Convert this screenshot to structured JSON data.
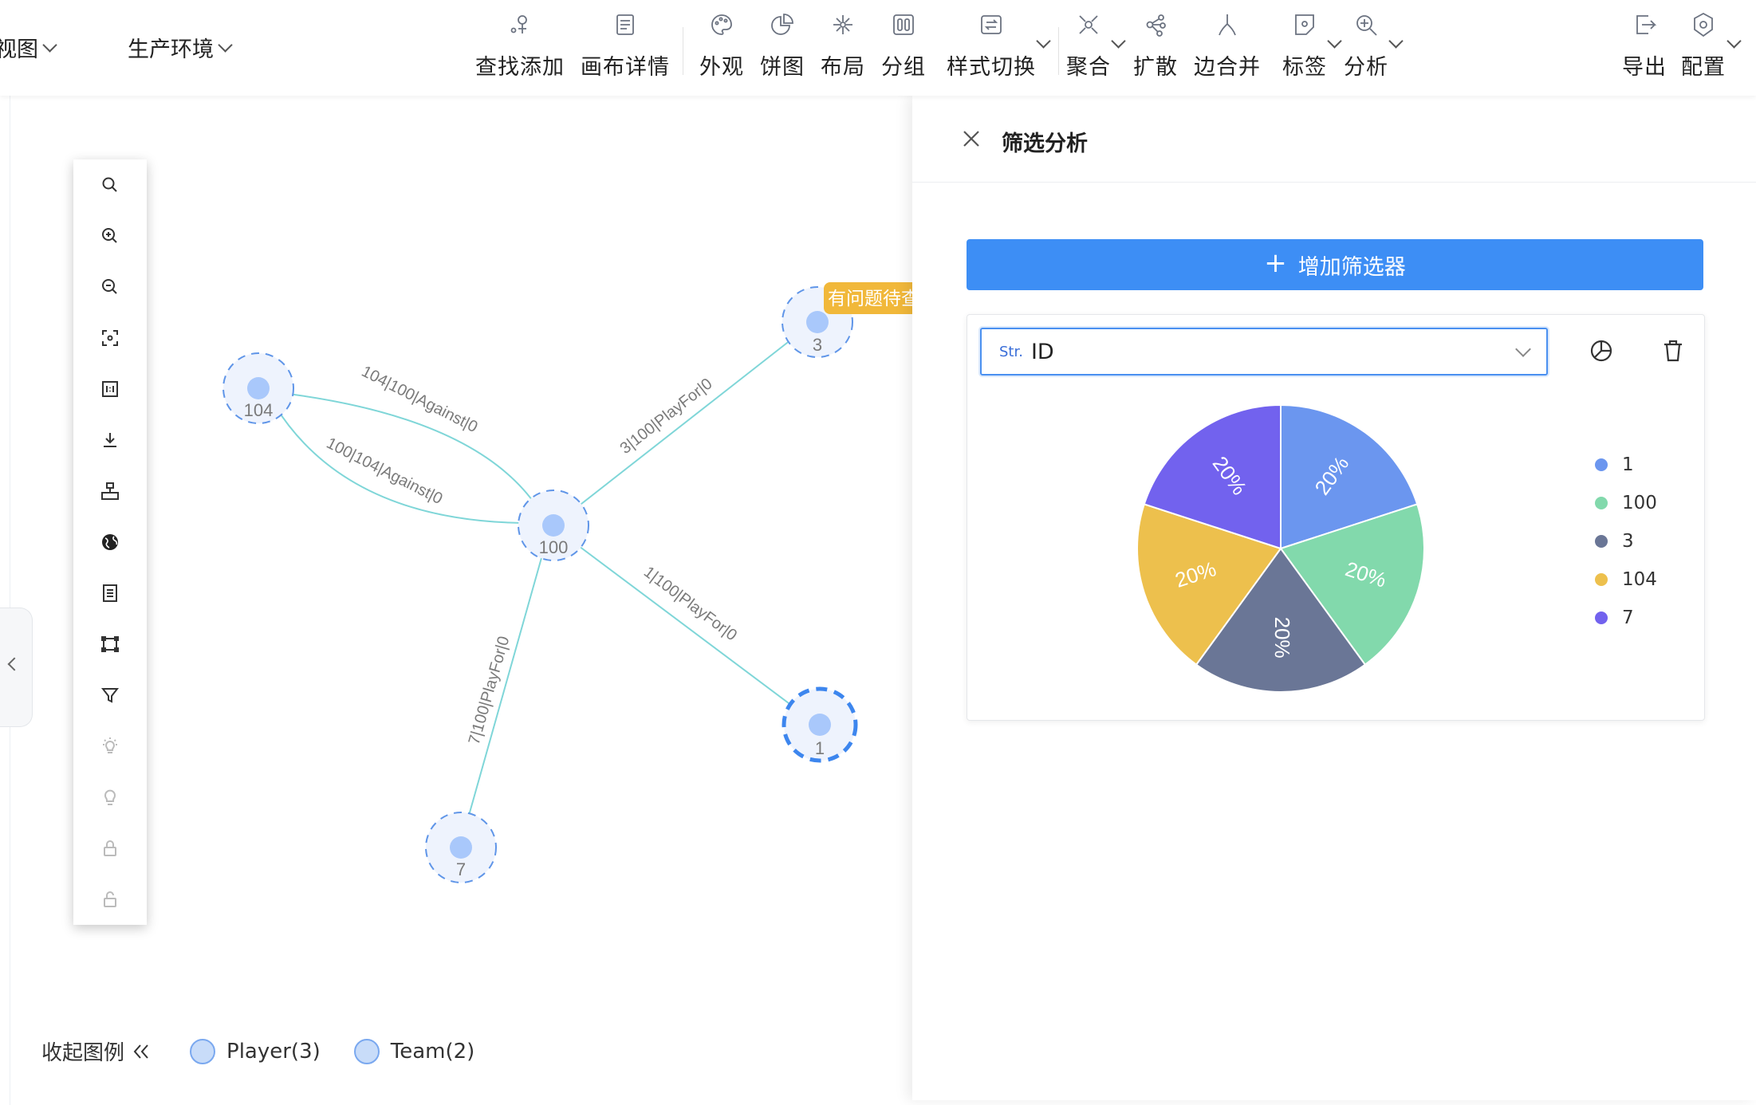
{
  "topbar": {
    "view_dropdown": "视图",
    "env_dropdown": "生产环境",
    "tools": [
      {
        "label": "查找添加",
        "icon": "search-add-icon"
      },
      {
        "label": "画布详情",
        "icon": "canvas-detail-icon"
      },
      {
        "label": "外观",
        "icon": "palette-icon"
      },
      {
        "label": "饼图",
        "icon": "pie-chart-icon"
      },
      {
        "label": "布局",
        "icon": "layout-icon"
      },
      {
        "label": "分组",
        "icon": "group-icon"
      },
      {
        "label": "样式切换",
        "icon": "style-switch-icon"
      },
      {
        "label": "聚合",
        "icon": "aggregate-icon"
      },
      {
        "label": "扩散",
        "icon": "expand-icon"
      },
      {
        "label": "边合并",
        "icon": "edge-merge-icon"
      },
      {
        "label": "标签",
        "icon": "tag-icon"
      },
      {
        "label": "分析",
        "icon": "analysis-icon"
      },
      {
        "label": "导出",
        "icon": "export-icon"
      },
      {
        "label": "配置",
        "icon": "settings-icon"
      }
    ]
  },
  "graph": {
    "nodes": [
      {
        "id": "104",
        "label": "104"
      },
      {
        "id": "100",
        "label": "100"
      },
      {
        "id": "3",
        "label": "3"
      },
      {
        "id": "1",
        "label": "1"
      },
      {
        "id": "7",
        "label": "7"
      }
    ],
    "edges": [
      {
        "label": "104|100|Against|0"
      },
      {
        "label": "100|104|Against|0"
      },
      {
        "label": "3|100|PlayFor|0"
      },
      {
        "label": "1|100|PlayFor|0"
      },
      {
        "label": "7|100|PlayFor|0"
      }
    ],
    "node3_badge": "有问题待查"
  },
  "legend": {
    "collapse_label": "收起图例",
    "items": [
      "Player(3)",
      "Team(2)"
    ]
  },
  "panel": {
    "title": "筛选分析",
    "add_button": "增加筛选器",
    "select_type": "Str.",
    "select_value": "ID"
  },
  "colors": {
    "accent": "#3d8ef5",
    "edge": "#7fd6d8",
    "node_fill": "#a9c8fb",
    "badge": "#f1b83a"
  },
  "chart_data": {
    "type": "pie",
    "categories": [
      "1",
      "100",
      "3",
      "104",
      "7"
    ],
    "values": [
      20,
      20,
      20,
      20,
      20
    ],
    "labels": [
      "20%",
      "20%",
      "20%",
      "20%",
      "20%"
    ],
    "colors": [
      "#6b96ef",
      "#82d9ac",
      "#6a7696",
      "#edc04d",
      "#7262ee"
    ],
    "legend_position": "right"
  }
}
